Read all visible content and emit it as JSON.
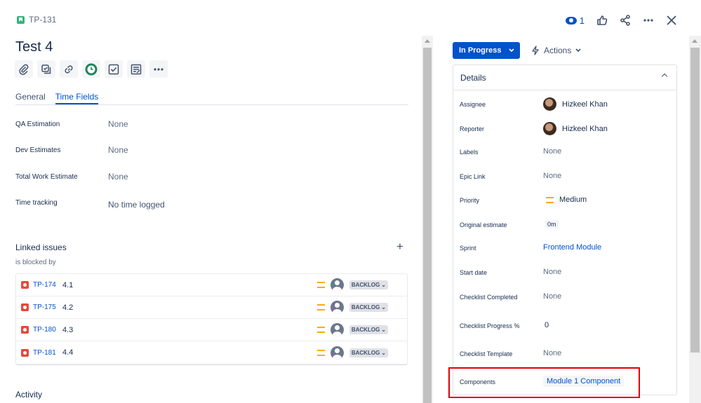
{
  "header": {
    "issue_key": "TP-131",
    "watch_count": "1"
  },
  "issue": {
    "title": "Test 4"
  },
  "toolbar": {
    "buttons": [
      "attach-icon",
      "subtask-icon",
      "link-icon",
      "timer-icon",
      "checklist-icon",
      "template-icon",
      "more-icon"
    ]
  },
  "tabs": [
    {
      "label": "General"
    },
    {
      "label": "Time Fields"
    }
  ],
  "time_fields": [
    {
      "label": "QA Estimation",
      "value": "None"
    },
    {
      "label": "Dev Estimates",
      "value": "None"
    },
    {
      "label": "Total Work Estimate",
      "value": "None"
    },
    {
      "label": "Time tracking",
      "value": "No time logged"
    }
  ],
  "linked_issues": {
    "title": "Linked issues",
    "relation": "is blocked by",
    "items": [
      {
        "key": "TP-174",
        "summary": "4.1",
        "status": "BACKLOG"
      },
      {
        "key": "TP-175",
        "summary": "4.2",
        "status": "BACKLOG"
      },
      {
        "key": "TP-180",
        "summary": "4.3",
        "status": "BACKLOG"
      },
      {
        "key": "TP-181",
        "summary": "4.4",
        "status": "BACKLOG"
      }
    ]
  },
  "activity": {
    "title": "Activity"
  },
  "status_button": {
    "label": "In Progress"
  },
  "actions_button": {
    "label": "Actions"
  },
  "details": {
    "title": "Details",
    "rows": [
      {
        "label": "Assignee",
        "value": "Hizkeel Khan"
      },
      {
        "label": "Reporter",
        "value": "Hizkeel Khan"
      },
      {
        "label": "Labels",
        "value": "None"
      },
      {
        "label": "Epic Link",
        "value": "None"
      },
      {
        "label": "Priority",
        "value": "Medium"
      },
      {
        "label": "Original estimate",
        "value": "0m"
      },
      {
        "label": "Sprint",
        "value": "Frontend Module"
      },
      {
        "label": "Start date",
        "value": "None"
      },
      {
        "label": "Checklist Completed",
        "value": "None"
      },
      {
        "label": "Checklist Progress %",
        "value": "0"
      },
      {
        "label": "Checklist Template",
        "value": "None"
      },
      {
        "label": "Components",
        "value": "Module 1 Component"
      }
    ]
  },
  "colors": {
    "primary": "#0052cc",
    "story": "#36b37e",
    "bug": "#e5493a",
    "priority_medium": "#ffab00",
    "highlight": "#e00000"
  }
}
